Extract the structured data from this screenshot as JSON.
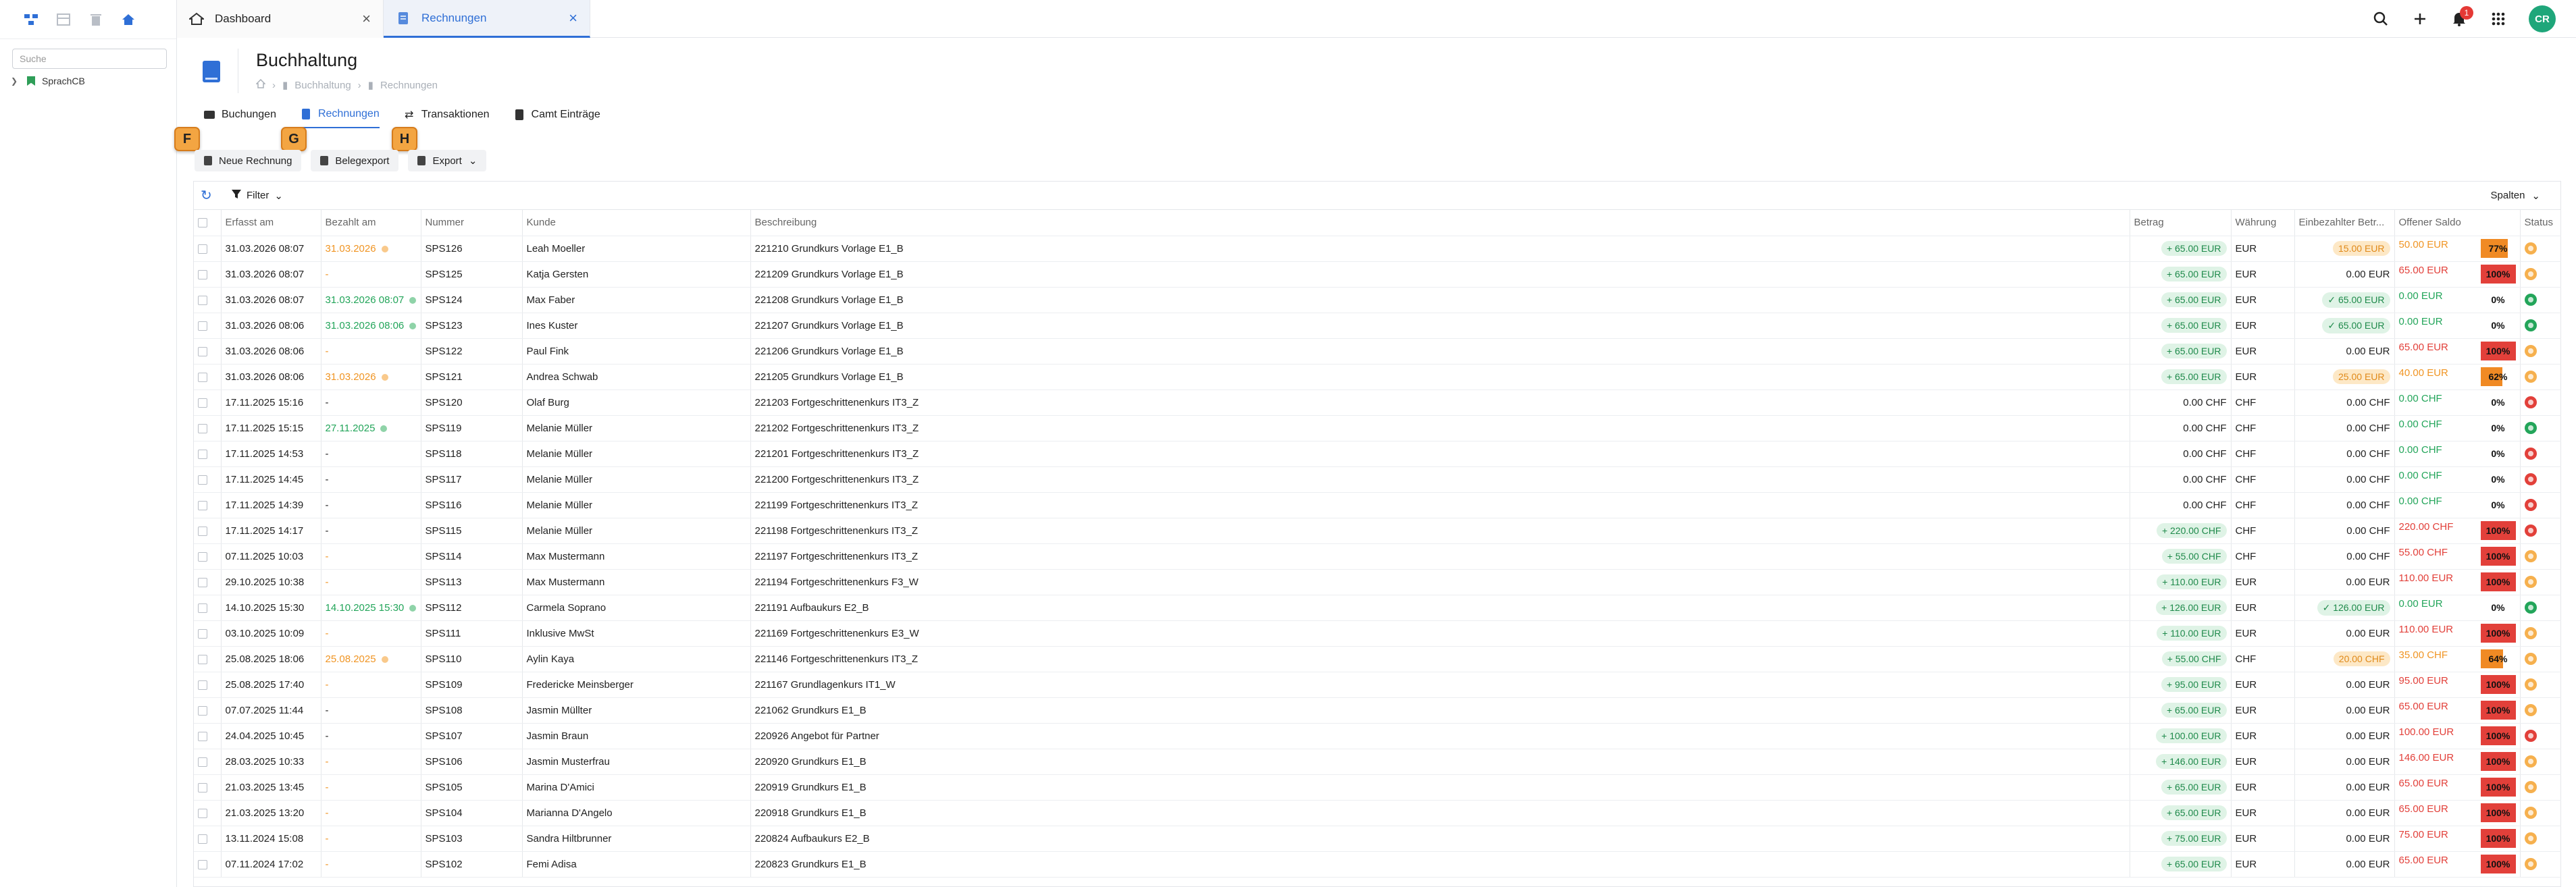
{
  "sidebar": {
    "search_placeholder": "Suche",
    "tree_item": "SprachCB"
  },
  "tabs": [
    {
      "label": "Dashboard",
      "icon": "home-icon"
    },
    {
      "label": "Rechnungen",
      "icon": "document-icon"
    }
  ],
  "user": {
    "initials": "CR",
    "notifications": "1"
  },
  "page": {
    "title": "Buchhaltung",
    "breadcrumb": [
      "Buchhaltung",
      "Rechnungen"
    ]
  },
  "section_tabs": [
    {
      "label": "Buchungen"
    },
    {
      "label": "Rechnungen"
    },
    {
      "label": "Transaktionen"
    },
    {
      "label": "Camt Einträge"
    }
  ],
  "toolbar": {
    "new_invoice": "Neue Rechnung",
    "export_receipts": "Belegexport",
    "export": "Export"
  },
  "hints": [
    "F",
    "G",
    "H"
  ],
  "grid": {
    "filter_label": "Filter",
    "columns_label": "Spalten",
    "columns": [
      "Erfasst am",
      "Bezahlt am",
      "Nummer",
      "Kunde",
      "Beschreibung",
      "Betrag",
      "Währung",
      "Einbezahlter Betr...",
      "Offener Saldo",
      "Status"
    ],
    "rows": [
      {
        "erfasst": "31.03.2026 08:07",
        "bezahlt": "31.03.2026",
        "bez_state": "orange",
        "nummer": "SPS126",
        "kunde": "Leah Moeller",
        "beschreibung": "221210 Grundkurs Vorlage E1_B",
        "betrag": "+ 65.00 EUR",
        "betrag_pill": true,
        "waehrung": "EUR",
        "einbezahlt": "15.00 EUR",
        "ein_state": "orange",
        "saldo": "50.00 EUR",
        "saldo_state": "orange",
        "pct": 77,
        "pct_label": "77%",
        "status": "pend"
      },
      {
        "erfasst": "31.03.2026 08:07",
        "bezahlt": "-",
        "bez_state": "orange",
        "nummer": "SPS125",
        "kunde": "Katja Gersten",
        "beschreibung": "221209 Grundkurs Vorlage E1_B",
        "betrag": "+ 65.00 EUR",
        "betrag_pill": true,
        "waehrung": "EUR",
        "einbezahlt": "0.00 EUR",
        "ein_state": "plain",
        "saldo": "65.00 EUR",
        "saldo_state": "red",
        "pct": 100,
        "pct_label": "100%",
        "status": "pend"
      },
      {
        "erfasst": "31.03.2026 08:07",
        "bezahlt": "31.03.2026 08:07",
        "bez_state": "green",
        "nummer": "SPS124",
        "kunde": "Max Faber",
        "beschreibung": "221208 Grundkurs Vorlage E1_B",
        "betrag": "+ 65.00 EUR",
        "betrag_pill": true,
        "waehrung": "EUR",
        "einbezahlt": "✓ 65.00 EUR",
        "ein_state": "green",
        "saldo": "0.00 EUR",
        "saldo_state": "green",
        "pct": 0,
        "pct_label": "0%",
        "status": "ok"
      },
      {
        "erfasst": "31.03.2026 08:06",
        "bezahlt": "31.03.2026 08:06",
        "bez_state": "green",
        "nummer": "SPS123",
        "kunde": "Ines Kuster",
        "beschreibung": "221207 Grundkurs Vorlage E1_B",
        "betrag": "+ 65.00 EUR",
        "betrag_pill": true,
        "waehrung": "EUR",
        "einbezahlt": "✓ 65.00 EUR",
        "ein_state": "green",
        "saldo": "0.00 EUR",
        "saldo_state": "green",
        "pct": 0,
        "pct_label": "0%",
        "status": "ok"
      },
      {
        "erfasst": "31.03.2026 08:06",
        "bezahlt": "-",
        "bez_state": "orange",
        "nummer": "SPS122",
        "kunde": "Paul Fink",
        "beschreibung": "221206 Grundkurs Vorlage E1_B",
        "betrag": "+ 65.00 EUR",
        "betrag_pill": true,
        "waehrung": "EUR",
        "einbezahlt": "0.00 EUR",
        "ein_state": "plain",
        "saldo": "65.00 EUR",
        "saldo_state": "red",
        "pct": 100,
        "pct_label": "100%",
        "status": "pend"
      },
      {
        "erfasst": "31.03.2026 08:06",
        "bezahlt": "31.03.2026",
        "bez_state": "orange",
        "nummer": "SPS121",
        "kunde": "Andrea Schwab",
        "beschreibung": "221205 Grundkurs Vorlage E1_B",
        "betrag": "+ 65.00 EUR",
        "betrag_pill": true,
        "waehrung": "EUR",
        "einbezahlt": "25.00 EUR",
        "ein_state": "orange",
        "saldo": "40.00 EUR",
        "saldo_state": "orange",
        "pct": 62,
        "pct_label": "62%",
        "status": "pend"
      },
      {
        "erfasst": "17.11.2025 15:16",
        "bezahlt": "-",
        "bez_state": "plain",
        "nummer": "SPS120",
        "kunde": "Olaf Burg",
        "beschreibung": "221203 Fortgeschrittenenkurs IT3_Z",
        "betrag": "0.00 CHF",
        "betrag_pill": false,
        "waehrung": "CHF",
        "einbezahlt": "0.00 CHF",
        "ein_state": "plain",
        "saldo": "0.00 CHF",
        "saldo_state": "green",
        "pct": 0,
        "pct_label": "0%",
        "status": "err"
      },
      {
        "erfasst": "17.11.2025 15:15",
        "bezahlt": "27.11.2025",
        "bez_state": "green",
        "nummer": "SPS119",
        "kunde": "Melanie Müller",
        "beschreibung": "221202 Fortgeschrittenenkurs IT3_Z",
        "betrag": "0.00 CHF",
        "betrag_pill": false,
        "waehrung": "CHF",
        "einbezahlt": "0.00 CHF",
        "ein_state": "plain",
        "saldo": "0.00 CHF",
        "saldo_state": "green",
        "pct": 0,
        "pct_label": "0%",
        "status": "ok"
      },
      {
        "erfasst": "17.11.2025 14:53",
        "bezahlt": "-",
        "bez_state": "plain",
        "nummer": "SPS118",
        "kunde": "Melanie Müller",
        "beschreibung": "221201 Fortgeschrittenenkurs IT3_Z",
        "betrag": "0.00 CHF",
        "betrag_pill": false,
        "waehrung": "CHF",
        "einbezahlt": "0.00 CHF",
        "ein_state": "plain",
        "saldo": "0.00 CHF",
        "saldo_state": "green",
        "pct": 0,
        "pct_label": "0%",
        "status": "err"
      },
      {
        "erfasst": "17.11.2025 14:45",
        "bezahlt": "-",
        "bez_state": "plain",
        "nummer": "SPS117",
        "kunde": "Melanie Müller",
        "beschreibung": "221200 Fortgeschrittenenkurs IT3_Z",
        "betrag": "0.00 CHF",
        "betrag_pill": false,
        "waehrung": "CHF",
        "einbezahlt": "0.00 CHF",
        "ein_state": "plain",
        "saldo": "0.00 CHF",
        "saldo_state": "green",
        "pct": 0,
        "pct_label": "0%",
        "status": "err"
      },
      {
        "erfasst": "17.11.2025 14:39",
        "bezahlt": "-",
        "bez_state": "plain",
        "nummer": "SPS116",
        "kunde": "Melanie Müller",
        "beschreibung": "221199 Fortgeschrittenenkurs IT3_Z",
        "betrag": "0.00 CHF",
        "betrag_pill": false,
        "waehrung": "CHF",
        "einbezahlt": "0.00 CHF",
        "ein_state": "plain",
        "saldo": "0.00 CHF",
        "saldo_state": "green",
        "pct": 0,
        "pct_label": "0%",
        "status": "err"
      },
      {
        "erfasst": "17.11.2025 14:17",
        "bezahlt": "-",
        "bez_state": "plain",
        "nummer": "SPS115",
        "kunde": "Melanie Müller",
        "beschreibung": "221198 Fortgeschrittenenkurs IT3_Z",
        "betrag": "+ 220.00 CHF",
        "betrag_pill": true,
        "waehrung": "CHF",
        "einbezahlt": "0.00 CHF",
        "ein_state": "plain",
        "saldo": "220.00 CHF",
        "saldo_state": "red",
        "pct": 100,
        "pct_label": "100%",
        "status": "err"
      },
      {
        "erfasst": "07.11.2025 10:03",
        "bezahlt": "-",
        "bez_state": "orange",
        "nummer": "SPS114",
        "kunde": "Max Mustermann",
        "beschreibung": "221197 Fortgeschrittenenkurs IT3_Z",
        "betrag": "+ 55.00 CHF",
        "betrag_pill": true,
        "waehrung": "CHF",
        "einbezahlt": "0.00 CHF",
        "ein_state": "plain",
        "saldo": "55.00 CHF",
        "saldo_state": "red",
        "pct": 100,
        "pct_label": "100%",
        "status": "pend"
      },
      {
        "erfasst": "29.10.2025 10:38",
        "bezahlt": "-",
        "bez_state": "orange",
        "nummer": "SPS113",
        "kunde": "Max Mustermann",
        "beschreibung": "221194 Fortgeschrittenenkurs F3_W",
        "betrag": "+ 110.00 EUR",
        "betrag_pill": true,
        "waehrung": "EUR",
        "einbezahlt": "0.00 EUR",
        "ein_state": "plain",
        "saldo": "110.00 EUR",
        "saldo_state": "red",
        "pct": 100,
        "pct_label": "100%",
        "status": "pend"
      },
      {
        "erfasst": "14.10.2025 15:30",
        "bezahlt": "14.10.2025 15:30",
        "bez_state": "green",
        "nummer": "SPS112",
        "kunde": "Carmela Soprano",
        "beschreibung": "221191 Aufbaukurs E2_B",
        "betrag": "+ 126.00 EUR",
        "betrag_pill": true,
        "waehrung": "EUR",
        "einbezahlt": "✓ 126.00 EUR",
        "ein_state": "green",
        "saldo": "0.00 EUR",
        "saldo_state": "green",
        "pct": 0,
        "pct_label": "0%",
        "status": "ok"
      },
      {
        "erfasst": "03.10.2025 10:09",
        "bezahlt": "-",
        "bez_state": "orange",
        "nummer": "SPS111",
        "kunde": "Inklusive MwSt",
        "beschreibung": "221169 Fortgeschrittenenkurs E3_W",
        "betrag": "+ 110.00 EUR",
        "betrag_pill": true,
        "waehrung": "EUR",
        "einbezahlt": "0.00 EUR",
        "ein_state": "plain",
        "saldo": "110.00 EUR",
        "saldo_state": "red",
        "pct": 100,
        "pct_label": "100%",
        "status": "pend"
      },
      {
        "erfasst": "25.08.2025 18:06",
        "bezahlt": "25.08.2025",
        "bez_state": "orange",
        "nummer": "SPS110",
        "kunde": "Aylin Kaya",
        "beschreibung": "221146 Fortgeschrittenenkurs IT3_Z",
        "betrag": "+ 55.00 CHF",
        "betrag_pill": true,
        "waehrung": "CHF",
        "einbezahlt": "20.00 CHF",
        "ein_state": "orange",
        "saldo": "35.00 CHF",
        "saldo_state": "orange",
        "pct": 64,
        "pct_label": "64%",
        "status": "pend"
      },
      {
        "erfasst": "25.08.2025 17:40",
        "bezahlt": "-",
        "bez_state": "orange",
        "nummer": "SPS109",
        "kunde": "Fredericke Meinsberger",
        "beschreibung": "221167 Grundlagenkurs IT1_W",
        "betrag": "+ 95.00 EUR",
        "betrag_pill": true,
        "waehrung": "EUR",
        "einbezahlt": "0.00 EUR",
        "ein_state": "plain",
        "saldo": "95.00 EUR",
        "saldo_state": "red",
        "pct": 100,
        "pct_label": "100%",
        "status": "pend"
      },
      {
        "erfasst": "07.07.2025 11:44",
        "bezahlt": "-",
        "bez_state": "plain",
        "nummer": "SPS108",
        "kunde": "Jasmin Müllter",
        "beschreibung": "221062 Grundkurs E1_B",
        "betrag": "+ 65.00 EUR",
        "betrag_pill": true,
        "waehrung": "EUR",
        "einbezahlt": "0.00 EUR",
        "ein_state": "plain",
        "saldo": "65.00 EUR",
        "saldo_state": "red",
        "pct": 100,
        "pct_label": "100%",
        "status": "pend"
      },
      {
        "erfasst": "24.04.2025 10:45",
        "bezahlt": "-",
        "bez_state": "plain",
        "nummer": "SPS107",
        "kunde": "Jasmin Braun",
        "beschreibung": "220926 Angebot für Partner",
        "betrag": "+ 100.00 EUR",
        "betrag_pill": true,
        "waehrung": "EUR",
        "einbezahlt": "0.00 EUR",
        "ein_state": "plain",
        "saldo": "100.00 EUR",
        "saldo_state": "red",
        "pct": 100,
        "pct_label": "100%",
        "status": "err"
      },
      {
        "erfasst": "28.03.2025 10:33",
        "bezahlt": "-",
        "bez_state": "orange",
        "nummer": "SPS106",
        "kunde": "Jasmin Musterfrau",
        "beschreibung": "220920 Grundkurs E1_B",
        "betrag": "+ 146.00 EUR",
        "betrag_pill": true,
        "waehrung": "EUR",
        "einbezahlt": "0.00 EUR",
        "ein_state": "plain",
        "saldo": "146.00 EUR",
        "saldo_state": "red",
        "pct": 100,
        "pct_label": "100%",
        "status": "pend"
      },
      {
        "erfasst": "21.03.2025 13:45",
        "bezahlt": "-",
        "bez_state": "orange",
        "nummer": "SPS105",
        "kunde": "Marina D'Amici",
        "beschreibung": "220919 Grundkurs E1_B",
        "betrag": "+ 65.00 EUR",
        "betrag_pill": true,
        "waehrung": "EUR",
        "einbezahlt": "0.00 EUR",
        "ein_state": "plain",
        "saldo": "65.00 EUR",
        "saldo_state": "red",
        "pct": 100,
        "pct_label": "100%",
        "status": "pend"
      },
      {
        "erfasst": "21.03.2025 13:20",
        "bezahlt": "-",
        "bez_state": "orange",
        "nummer": "SPS104",
        "kunde": "Marianna D'Angelo",
        "beschreibung": "220918 Grundkurs E1_B",
        "betrag": "+ 65.00 EUR",
        "betrag_pill": true,
        "waehrung": "EUR",
        "einbezahlt": "0.00 EUR",
        "ein_state": "plain",
        "saldo": "65.00 EUR",
        "saldo_state": "red",
        "pct": 100,
        "pct_label": "100%",
        "status": "pend"
      },
      {
        "erfasst": "13.11.2024 15:08",
        "bezahlt": "-",
        "bez_state": "orange",
        "nummer": "SPS103",
        "kunde": "Sandra Hiltbrunner",
        "beschreibung": "220824 Aufbaukurs E2_B",
        "betrag": "+ 75.00 EUR",
        "betrag_pill": true,
        "waehrung": "EUR",
        "einbezahlt": "0.00 EUR",
        "ein_state": "plain",
        "saldo": "75.00 EUR",
        "saldo_state": "red",
        "pct": 100,
        "pct_label": "100%",
        "status": "pend"
      },
      {
        "erfasst": "07.11.2024 17:02",
        "bezahlt": "-",
        "bez_state": "orange",
        "nummer": "SPS102",
        "kunde": "Femi Adisa",
        "beschreibung": "220823 Grundkurs E1_B",
        "betrag": "+ 65.00 EUR",
        "betrag_pill": true,
        "waehrung": "EUR",
        "einbezahlt": "0.00 EUR",
        "ein_state": "plain",
        "saldo": "65.00 EUR",
        "saldo_state": "red",
        "pct": 100,
        "pct_label": "100%",
        "status": "pend"
      }
    ]
  }
}
